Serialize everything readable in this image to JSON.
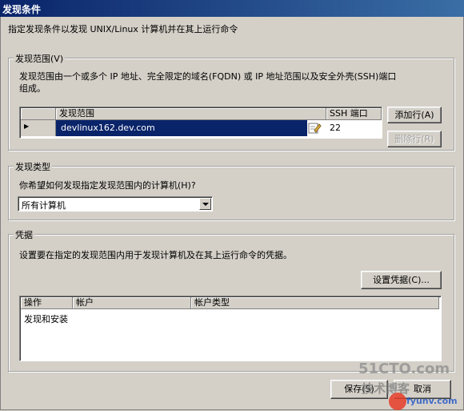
{
  "window": {
    "title": "发现条件"
  },
  "intro": "指定发现条件以发现 UNIX/Linux 计算机并在其上运行命令",
  "discovery_scope": {
    "legend": "发现范围(V)",
    "description_line1": "发现范围由一个或多个 IP 地址、完全限定的域名(FQDN) 或 IP 地址范围以及安全外壳(SSH)端口",
    "description_line2": "组成。",
    "columns": [
      "发现范围",
      "SSH 端口"
    ],
    "rows": [
      {
        "marker": "▶",
        "range": "devlinux162.dev.com",
        "ssh_port": "22"
      }
    ],
    "add_row_label": "添加行(A)",
    "remove_row_label": "删除行(R)"
  },
  "discovery_type": {
    "legend": "发现类型",
    "question": "你希望如何发现指定发现范围内的计算机(H)?",
    "selected": "所有计算机"
  },
  "credentials": {
    "legend": "凭据",
    "description": "设置要在指定的发现范围内用于发现计算机及在其上运行命令的凭据。",
    "set_credentials_label": "设置凭据(C)...",
    "columns": [
      "操作",
      "帐户",
      "帐户类型"
    ],
    "rows": [
      {
        "action": "发现和安装",
        "account": "",
        "account_type": ""
      }
    ]
  },
  "footer": {
    "save_label": "保存(S)",
    "cancel_label": "取消"
  },
  "watermark": {
    "brand": "51CTO.com",
    "subtitle": "技术博客",
    "site": "fyunv.com"
  }
}
